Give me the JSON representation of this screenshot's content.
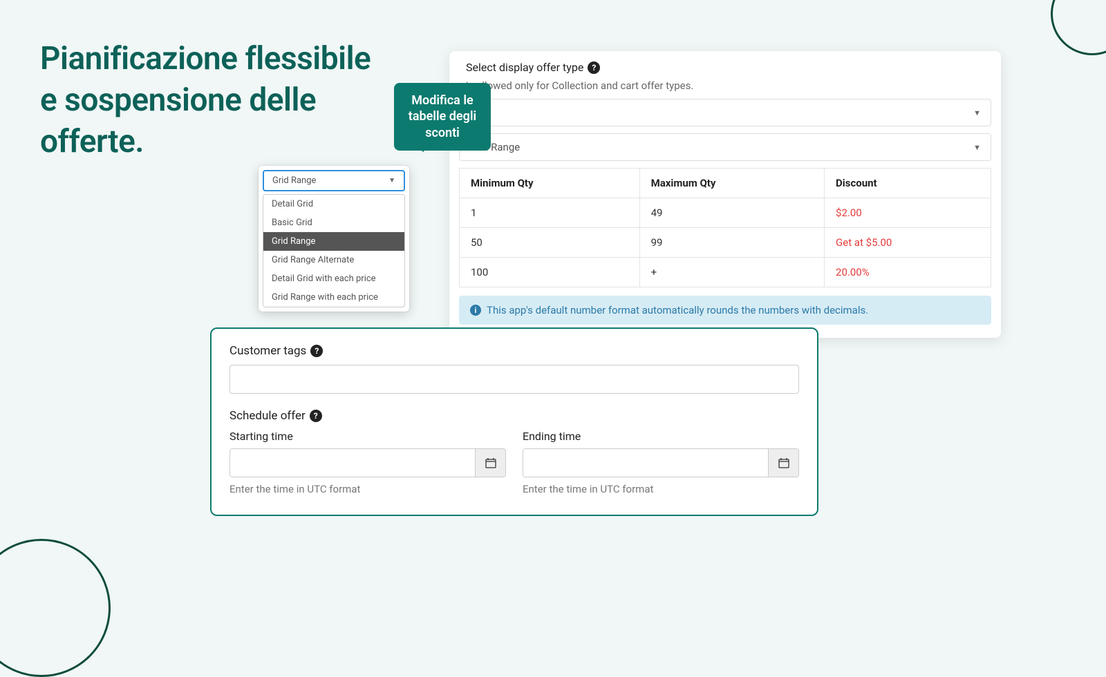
{
  "headline": "Pianificazione flessibile e sospensione delle offerte.",
  "tooltip": "Modifica le tabelle degli sconti",
  "dropdown": {
    "selected": "Grid Range",
    "options": [
      "Detail Grid",
      "Basic Grid",
      "Grid Range",
      "Grid Range Alternate",
      "Detail Grid with each price",
      "Grid Range with each price"
    ],
    "active_index": 2
  },
  "offer_card": {
    "title": "Select display offer type",
    "hint_suffix": "is allowed only for Collection and cart offer types.",
    "select2_value": "Grid Range",
    "table": {
      "headers": [
        "Minimum Qty",
        "Maximum Qty",
        "Discount"
      ],
      "rows": [
        {
          "min": "1",
          "max": "49",
          "discount": "$2.00"
        },
        {
          "min": "50",
          "max": "99",
          "discount": "Get at $5.00"
        },
        {
          "min": "100",
          "max": "+",
          "discount": "20.00%"
        }
      ]
    },
    "info_text": "This app's default number format automatically rounds the numbers with decimals."
  },
  "schedule": {
    "customer_tags_label": "Customer tags",
    "schedule_offer_label": "Schedule offer",
    "starting_label": "Starting time",
    "ending_label": "Ending time",
    "utc_hint": "Enter the time in UTC format"
  }
}
